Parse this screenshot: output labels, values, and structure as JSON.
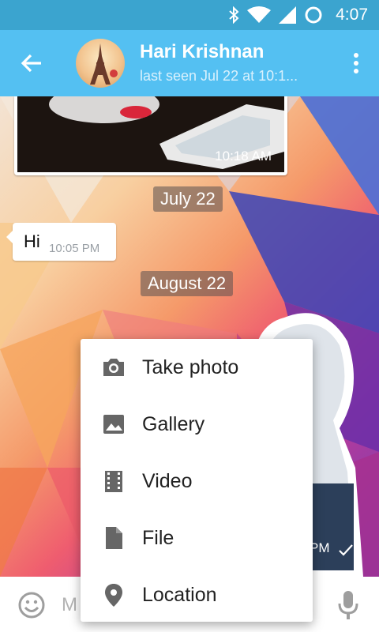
{
  "status_bar": {
    "time": "4:07",
    "icons": [
      "bluetooth-icon",
      "wifi-icon",
      "signal-icon",
      "sync-icon"
    ]
  },
  "header": {
    "back_icon": "arrow-left-icon",
    "contact_name": "Hari Krishnan",
    "contact_status": "last seen Jul 22 at 10:1...",
    "more_icon": "more-vertical-icon"
  },
  "chat": {
    "photo_message": {
      "time": "10:18 AM"
    },
    "date_separators": [
      "July 22",
      "August 22"
    ],
    "text_message": {
      "text": "Hi",
      "time": "10:05 PM"
    },
    "sticker_message": {
      "time_partial": "PM"
    }
  },
  "input": {
    "placeholder": "M",
    "emoji_icon": "emoji-icon",
    "mic_icon": "mic-icon"
  },
  "attach_menu": {
    "items": [
      {
        "label": "Take photo",
        "icon": "camera-icon"
      },
      {
        "label": "Gallery",
        "icon": "image-icon"
      },
      {
        "label": "Video",
        "icon": "film-icon"
      },
      {
        "label": "File",
        "icon": "file-icon"
      },
      {
        "label": "Location",
        "icon": "location-pin-icon"
      }
    ]
  },
  "colors": {
    "status_bar": "#3ba4cf",
    "app_bar": "#54c0f2",
    "menu_icon": "#666666"
  }
}
